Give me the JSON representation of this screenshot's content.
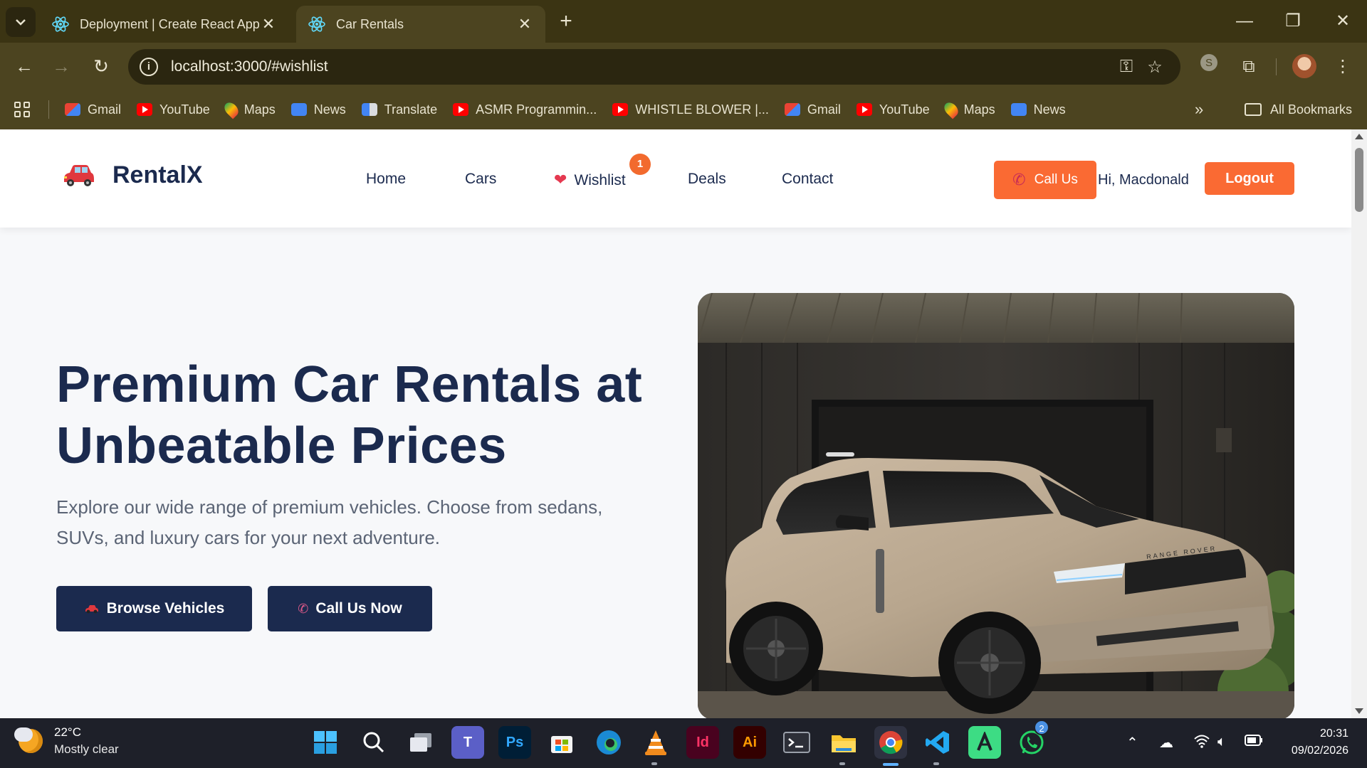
{
  "browser": {
    "tabs": [
      {
        "title": "Deployment | Create React App",
        "active": false
      },
      {
        "title": "Car Rentals",
        "active": true
      }
    ],
    "url": "localhost:3000/#wishlist",
    "bookmarks": [
      {
        "label": "Gmail",
        "icon": "gmail-icon"
      },
      {
        "label": "YouTube",
        "icon": "youtube-icon"
      },
      {
        "label": "Maps",
        "icon": "maps-icon"
      },
      {
        "label": "News",
        "icon": "news-icon"
      },
      {
        "label": "Translate",
        "icon": "translate-icon"
      },
      {
        "label": "ASMR Programmin...",
        "icon": "youtube-icon"
      },
      {
        "label": "WHISTLE BLOWER |...",
        "icon": "youtube-icon"
      },
      {
        "label": "Gmail",
        "icon": "gmail-icon"
      },
      {
        "label": "YouTube",
        "icon": "youtube-icon"
      },
      {
        "label": "Maps",
        "icon": "maps-icon"
      },
      {
        "label": "News",
        "icon": "news-icon"
      }
    ],
    "all_bookmarks": "All Bookmarks",
    "more_glyph": "»"
  },
  "site": {
    "brand": "RentalX",
    "nav": {
      "home": "Home",
      "cars": "Cars",
      "wishlist": "Wishlist",
      "wishlist_count": "1",
      "deals": "Deals",
      "contact": "Contact"
    },
    "call_us": "Call Us",
    "greeting": "Hi, Macdonald",
    "logout": "Logout",
    "hero": {
      "title": "Premium Car Rentals at Unbeatable Prices",
      "subtitle": "Explore our wide range of premium vehicles. Choose from sedans, SUVs, and luxury cars for your next adventure.",
      "browse_button": "Browse Vehicles",
      "call_button": "Call Us Now",
      "grille_text": "RANGE ROVER"
    },
    "colors": {
      "navy": "#1b2a4e",
      "orange": "#fa6a33"
    }
  },
  "taskbar": {
    "temperature": "22°C",
    "condition": "Mostly clear",
    "time": "20:31",
    "date": "09/02/2026",
    "whatsapp_badge": "2",
    "apps": [
      "windows-start-icon",
      "search-icon",
      "task-view-icon",
      "teams-icon",
      "photoshop-icon",
      "microsoft-store-icon",
      "edge-icon",
      "vlc-icon",
      "indesign-icon",
      "illustrator-icon",
      "terminal-icon",
      "file-explorer-icon",
      "chrome-icon",
      "vscode-icon",
      "android-studio-icon",
      "whatsapp-icon"
    ],
    "app_labels": {
      "photoshop": "Ps",
      "indesign": "Id",
      "illustrator": "Ai"
    }
  }
}
